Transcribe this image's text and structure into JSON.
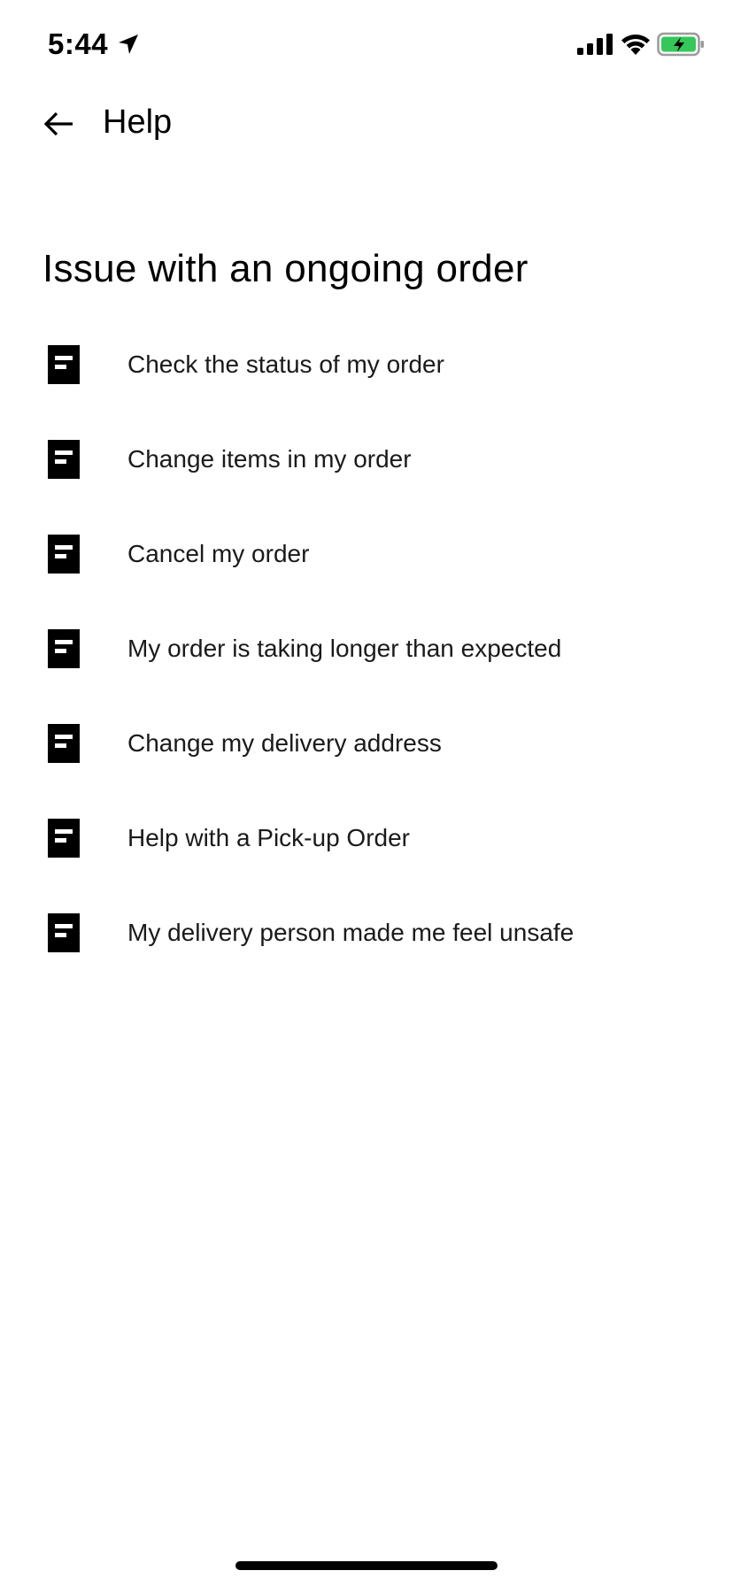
{
  "status_bar": {
    "time": "5:44",
    "battery_color": "#34c759"
  },
  "header": {
    "back_icon": "arrow-left-icon",
    "title": "Help"
  },
  "section": {
    "title": "Issue with an ongoing order"
  },
  "topics": [
    {
      "icon": "document-icon",
      "label": "Check the status of my order"
    },
    {
      "icon": "document-icon",
      "label": "Change items in my order"
    },
    {
      "icon": "document-icon",
      "label": "Cancel my order"
    },
    {
      "icon": "document-icon",
      "label": "My order is taking longer than expected"
    },
    {
      "icon": "document-icon",
      "label": "Change my delivery address"
    },
    {
      "icon": "document-icon",
      "label": "Help with a Pick-up Order"
    },
    {
      "icon": "document-icon",
      "label": "My delivery person made me feel unsafe"
    }
  ]
}
